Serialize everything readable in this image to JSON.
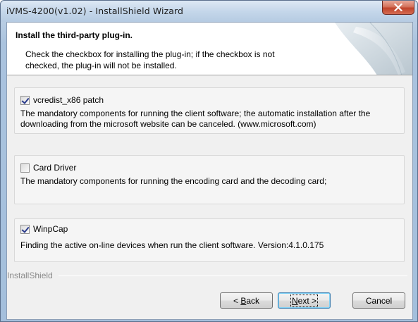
{
  "window": {
    "title": "iVMS-4200(v1.02) - InstallShield Wizard"
  },
  "header": {
    "title": "Install the third-party plug-in.",
    "description_line1": "Check the checkbox for installing the plug-in; if the checkbox is not",
    "description_line2": "checked, the plug-in will not be installed."
  },
  "plugins": [
    {
      "label": "vcredist_x86 patch",
      "checked": true,
      "desc_line1": "The mandatory components for running the client software; the automatic installation after the",
      "desc_line2": "downloading from the microsoft website can be canceled. (www.microsoft.com)"
    },
    {
      "label": "Card Driver",
      "checked": false,
      "desc_line1": "The mandatory components for running the encoding card and the decoding card;",
      "desc_line2": ""
    },
    {
      "label": "WinpCap",
      "checked": true,
      "desc_line1": "Finding the active on-line devices when run the client software. Version:4.1.0.175",
      "desc_line2": ""
    }
  ],
  "footer": {
    "brand": "InstallShield",
    "back_prefix": "< ",
    "back_mnemonic": "B",
    "back_rest": "ack",
    "next_mnemonic": "N",
    "next_rest": "ext >",
    "cancel_label": "Cancel"
  },
  "colors": {
    "title_bar": "#c5d7ea",
    "close_button": "#c0432a",
    "dialog_bg": "#f0f0f0",
    "default_button_border": "#3c7fb1"
  }
}
